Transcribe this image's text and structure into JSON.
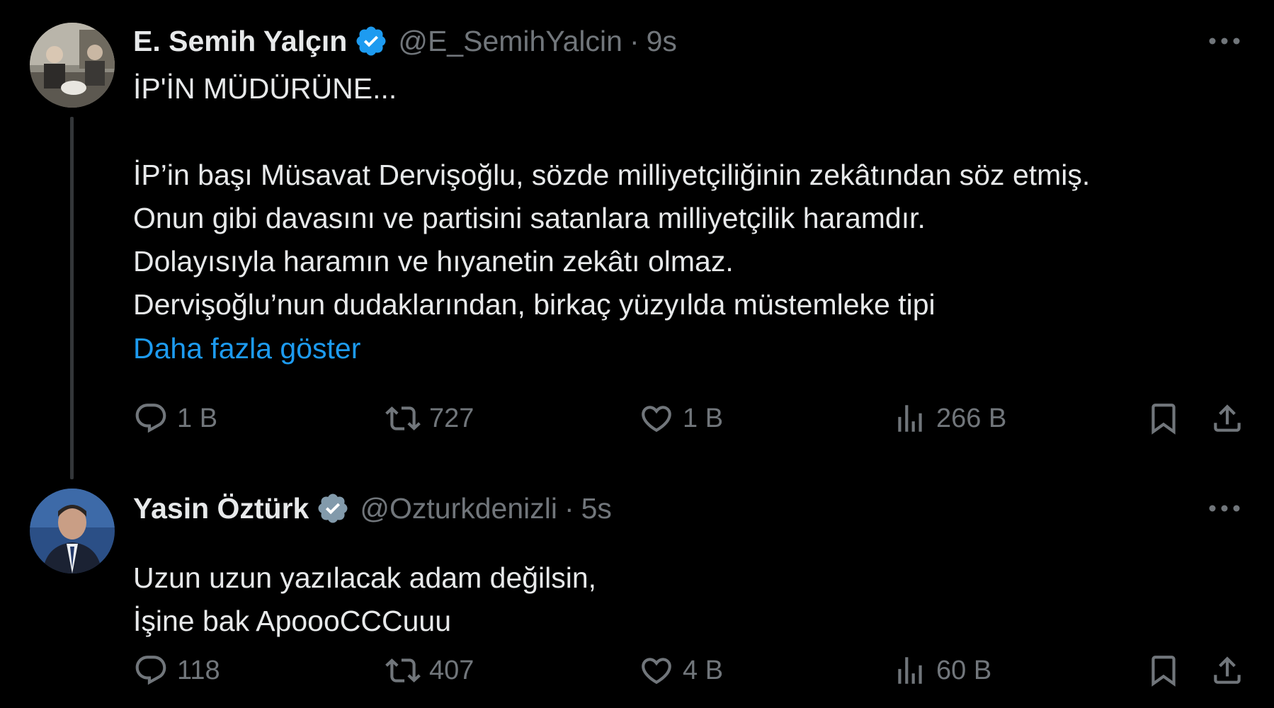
{
  "tweets": [
    {
      "display_name": "E. Semih Yalçın",
      "handle": "@E_SemihYalcin",
      "separator": "·",
      "timestamp": "9s",
      "verified": true,
      "verified_color": "#1d9bf0",
      "lines": [
        "İP'İN MÜDÜRÜNE...",
        "",
        "İP’in başı Müsavat Dervişoğlu, sözde milliyetçiliğinin zekâtından söz etmiş.",
        "Onun gibi davasını ve partisini satanlara milliyetçilik haramdır.",
        "Dolayısıyla haramın ve hıyanetin zekâtı olmaz.",
        "Dervişoğlu’nun dudaklarından, birkaç yüzyılda müstemleke tipi"
      ],
      "show_more": "Daha fazla göster",
      "stats": {
        "replies": "1 B",
        "reposts": "727",
        "likes": "1 B",
        "views": "266 B"
      }
    },
    {
      "display_name": "Yasin Öztürk",
      "handle": "@Ozturkdenizli",
      "separator": "·",
      "timestamp": "5s",
      "verified": true,
      "verified_color": "#829aab",
      "lines": [
        "Uzun uzun yazılacak adam değilsin,",
        "İşine bak ApoooCCCuuu"
      ],
      "stats": {
        "replies": "118",
        "reposts": "407",
        "likes": "4 B",
        "views": "60 B"
      }
    }
  ],
  "icons": {
    "reply": "reply-icon",
    "repost": "repost-icon",
    "like": "heart-icon",
    "views": "views-icon",
    "bookmark": "bookmark-icon",
    "share": "share-icon",
    "more": "more-icon"
  },
  "colors": {
    "background": "#000000",
    "text_primary": "#e7e9ea",
    "text_secondary": "#71767b",
    "link": "#1d9bf0",
    "thread_line": "#333639"
  }
}
